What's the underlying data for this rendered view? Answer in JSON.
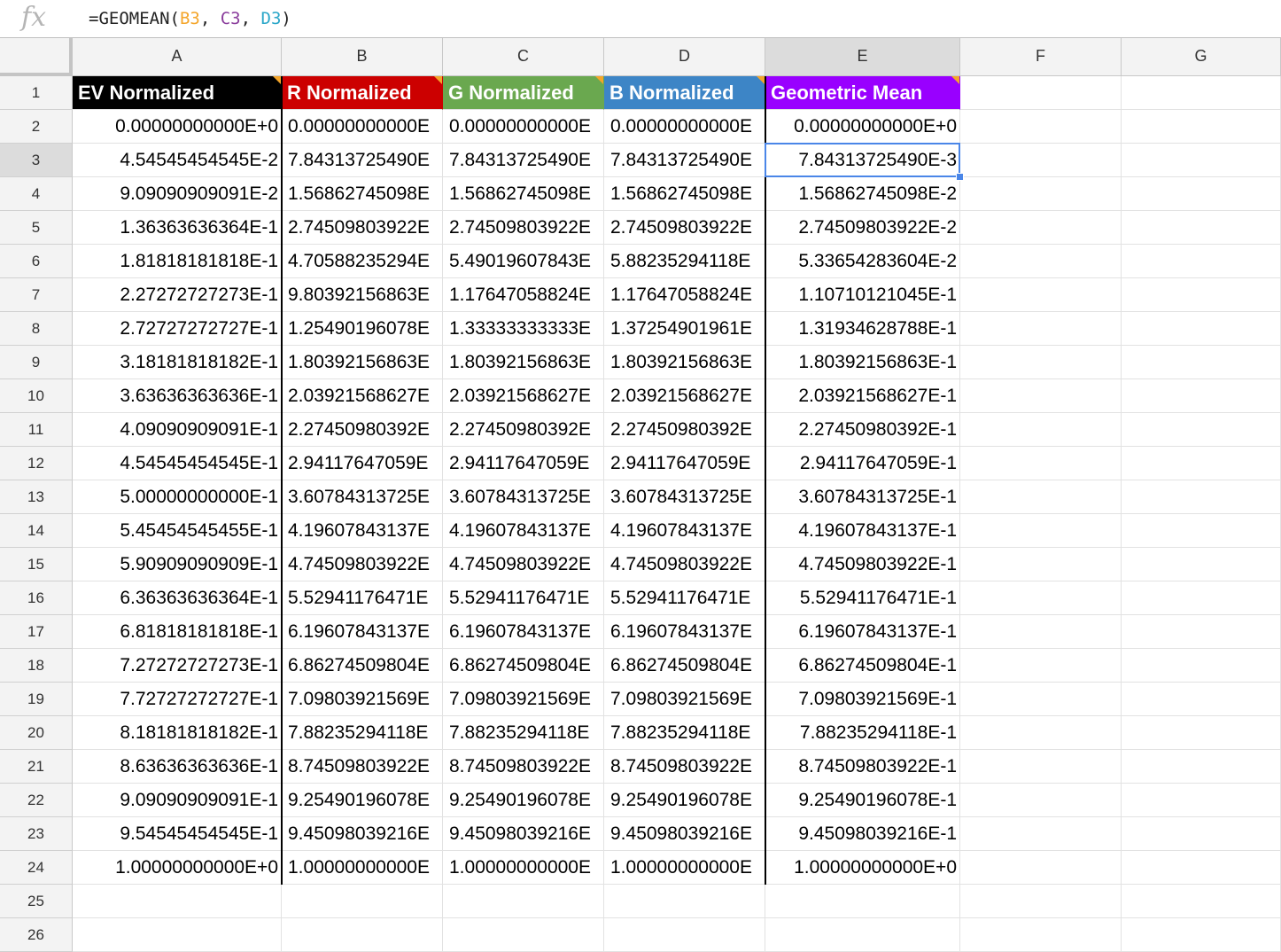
{
  "formula_bar": {
    "fx_label": "fx",
    "prefix": "=GEOMEAN(",
    "ref1": "B3",
    "sep1": ", ",
    "ref2": "C3",
    "sep2": ", ",
    "ref3": "D3",
    "suffix": ")"
  },
  "columns": [
    "A",
    "B",
    "C",
    "D",
    "E",
    "F",
    "G"
  ],
  "row_numbers": [
    "1",
    "2",
    "3",
    "4",
    "5",
    "6",
    "7",
    "8",
    "9",
    "10",
    "11",
    "12",
    "13",
    "14",
    "15",
    "16",
    "17",
    "18",
    "19",
    "20",
    "21",
    "22",
    "23",
    "24",
    "25",
    "26"
  ],
  "headers": [
    {
      "label": "EV Normalized",
      "color": "#000000"
    },
    {
      "label": "R Normalized",
      "color": "#cc0000"
    },
    {
      "label": "G Normalized",
      "color": "#6aa84f"
    },
    {
      "label": "B Normalized",
      "color": "#3d85c6"
    },
    {
      "label": "Geometric Mean",
      "color": "#9900ff"
    }
  ],
  "rows": [
    [
      "0.00000000000E+0",
      "0.00000000000E",
      "0.00000000000E",
      "0.00000000000E",
      "0.00000000000E+0"
    ],
    [
      "4.54545454545E-2",
      "7.84313725490E",
      "7.84313725490E",
      "7.84313725490E",
      "7.84313725490E-3"
    ],
    [
      "9.09090909091E-2",
      "1.56862745098E",
      "1.56862745098E",
      "1.56862745098E",
      "1.56862745098E-2"
    ],
    [
      "1.36363636364E-1",
      "2.74509803922E",
      "2.74509803922E",
      "2.74509803922E",
      "2.74509803922E-2"
    ],
    [
      "1.81818181818E-1",
      "4.70588235294E",
      "5.49019607843E",
      "5.88235294118E",
      "5.33654283604E-2"
    ],
    [
      "2.27272727273E-1",
      "9.80392156863E",
      "1.17647058824E",
      "1.17647058824E",
      "1.10710121045E-1"
    ],
    [
      "2.72727272727E-1",
      "1.25490196078E",
      "1.33333333333E",
      "1.37254901961E",
      "1.31934628788E-1"
    ],
    [
      "3.18181818182E-1",
      "1.80392156863E",
      "1.80392156863E",
      "1.80392156863E",
      "1.80392156863E-1"
    ],
    [
      "3.63636363636E-1",
      "2.03921568627E",
      "2.03921568627E",
      "2.03921568627E",
      "2.03921568627E-1"
    ],
    [
      "4.09090909091E-1",
      "2.27450980392E",
      "2.27450980392E",
      "2.27450980392E",
      "2.27450980392E-1"
    ],
    [
      "4.54545454545E-1",
      "2.94117647059E",
      "2.94117647059E",
      "2.94117647059E",
      "2.94117647059E-1"
    ],
    [
      "5.00000000000E-1",
      "3.60784313725E",
      "3.60784313725E",
      "3.60784313725E",
      "3.60784313725E-1"
    ],
    [
      "5.45454545455E-1",
      "4.19607843137E",
      "4.19607843137E",
      "4.19607843137E",
      "4.19607843137E-1"
    ],
    [
      "5.90909090909E-1",
      "4.74509803922E",
      "4.74509803922E",
      "4.74509803922E",
      "4.74509803922E-1"
    ],
    [
      "6.36363636364E-1",
      "5.52941176471E",
      "5.52941176471E",
      "5.52941176471E",
      "5.52941176471E-1"
    ],
    [
      "6.81818181818E-1",
      "6.19607843137E",
      "6.19607843137E",
      "6.19607843137E",
      "6.19607843137E-1"
    ],
    [
      "7.27272727273E-1",
      "6.86274509804E",
      "6.86274509804E",
      "6.86274509804E",
      "6.86274509804E-1"
    ],
    [
      "7.72727272727E-1",
      "7.09803921569E",
      "7.09803921569E",
      "7.09803921569E",
      "7.09803921569E-1"
    ],
    [
      "8.18181818182E-1",
      "7.88235294118E",
      "7.88235294118E",
      "7.88235294118E",
      "7.88235294118E-1"
    ],
    [
      "8.63636363636E-1",
      "8.74509803922E",
      "8.74509803922E",
      "8.74509803922E",
      "8.74509803922E-1"
    ],
    [
      "9.09090909091E-1",
      "9.25490196078E",
      "9.25490196078E",
      "9.25490196078E",
      "9.25490196078E-1"
    ],
    [
      "9.54545454545E-1",
      "9.45098039216E",
      "9.45098039216E",
      "9.45098039216E",
      "9.45098039216E-1"
    ],
    [
      "1.00000000000E+0",
      "1.00000000000E",
      "1.00000000000E",
      "1.00000000000E",
      "1.00000000000E+0"
    ]
  ],
  "selection": {
    "cell": "E3",
    "border_color": "#4a86e8"
  },
  "note_color": "#f4a52a"
}
